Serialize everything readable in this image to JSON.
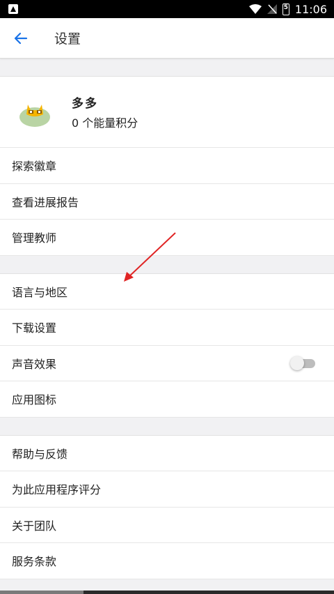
{
  "status_bar": {
    "time": "11:06",
    "battery_level": "5"
  },
  "header": {
    "title": "设置"
  },
  "profile": {
    "name": "多多",
    "points_text": "0 个能量积分"
  },
  "sections": [
    {
      "items": [
        {
          "label": "探索徽章"
        },
        {
          "label": "查看进展报告"
        },
        {
          "label": "管理教师"
        }
      ]
    },
    {
      "items": [
        {
          "label": "语言与地区"
        },
        {
          "label": "下载设置"
        },
        {
          "label": "声音效果",
          "toggle": false
        },
        {
          "label": "应用图标"
        }
      ]
    },
    {
      "items": [
        {
          "label": "帮助与反馈"
        },
        {
          "label": "为此应用程序评分"
        },
        {
          "label": "关于团队"
        },
        {
          "label": "服务条款"
        }
      ]
    }
  ],
  "colors": {
    "accent": "#1a73e8",
    "annotation_arrow": "#e02424"
  }
}
